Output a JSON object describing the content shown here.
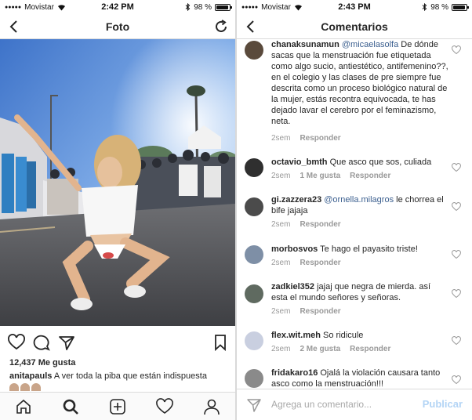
{
  "left": {
    "status": {
      "carrier": "Movistar",
      "time": "2:42 PM",
      "battery": "98 %",
      "battery_level": 0.98
    },
    "nav": {
      "title": "Foto"
    },
    "post": {
      "likes": "12,437 Me gusta",
      "caption_user": "anitapauls",
      "caption_text": "A ver toda la piba que están indispuesta"
    },
    "tabs": [
      "home-icon",
      "search-icon",
      "add-post-icon",
      "activity-heart-icon",
      "profile-icon"
    ]
  },
  "right": {
    "status": {
      "carrier": "Movistar",
      "time": "2:43 PM",
      "battery": "98 %",
      "battery_level": 0.98
    },
    "nav": {
      "title": "Comentarios"
    },
    "comments": [
      {
        "user": "chanaksunamun",
        "mention": "@micaelasolfa",
        "text": "De dónde sacas que la menstruación fue etiquetada como algo sucio, antiestético, antifemenino??, en el colegio y las clases de pre siempre fue descrita como un proceso biológico natural de la mujer, estás recontra equivocada, te has dejado lavar el cerebro por el feminazismo, neta.",
        "time": "2sem",
        "likes": "",
        "reply": "Responder"
      },
      {
        "user": "octavio_bmth",
        "mention": "",
        "text": "Que asco que sos, culiada",
        "time": "2sem",
        "likes": "1 Me gusta",
        "reply": "Responder"
      },
      {
        "user": "gi.zazzera23",
        "mention": "@ornella.milagros",
        "text": "le chorrea el bife jajaja",
        "time": "2sem",
        "likes": "",
        "reply": "Responder"
      },
      {
        "user": "morbosvos",
        "mention": "",
        "text": "Te hago el payasito triste!",
        "time": "2sem",
        "likes": "",
        "reply": "Responder"
      },
      {
        "user": "zadkiel352",
        "mention": "",
        "text": "jajaj que negra de mierda. así esta el mundo señores y señoras.",
        "time": "2sem",
        "likes": "",
        "reply": "Responder"
      },
      {
        "user": "flex.wit.meh",
        "mention": "",
        "text": "So ridicule",
        "time": "2sem",
        "likes": "2 Me gusta",
        "reply": "Responder"
      },
      {
        "user": "fridakaro16",
        "mention": "",
        "text": "Ojalá la violación causara tanto asco como la menstruación!!!",
        "time": "",
        "likes": "",
        "reply": ""
      }
    ],
    "composer": {
      "placeholder": "Agrega un comentario...",
      "post_label": "Publicar"
    }
  },
  "colors": {
    "mention": "#3b5f8f",
    "meta": "#999999",
    "post_disabled": "#b3d4f5",
    "border": "#dbdbdb"
  }
}
